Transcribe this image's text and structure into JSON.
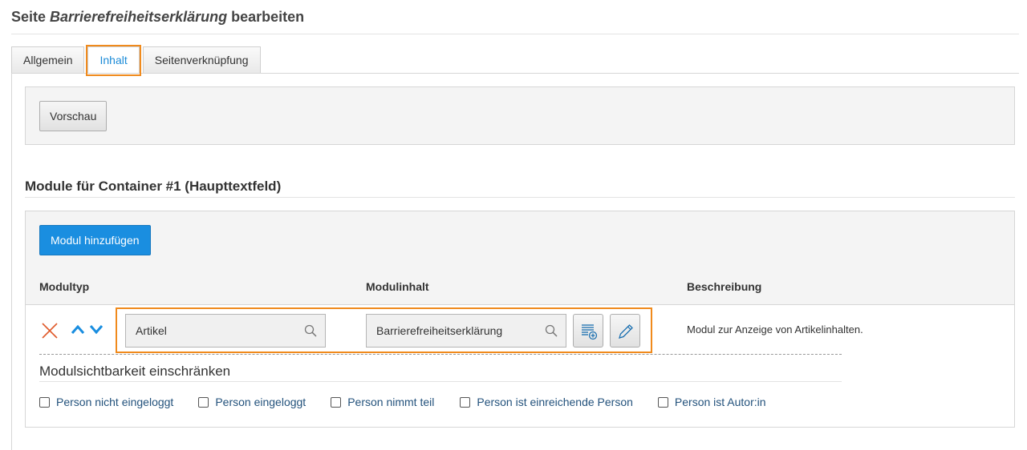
{
  "header": {
    "title_prefix": "Seite ",
    "title_name": "Barrierefreiheitserklärung",
    "title_suffix": " bearbeiten"
  },
  "tabs": [
    {
      "label": "Allgemein",
      "active": false
    },
    {
      "label": "Inhalt",
      "active": true
    },
    {
      "label": "Seitenverknüpfung",
      "active": false
    }
  ],
  "preview": {
    "button_label": "Vorschau"
  },
  "modules": {
    "section_title": "Module für Container #1 (Haupttextfeld)",
    "add_button_label": "Modul hinzufügen",
    "columns": {
      "type": "Modultyp",
      "content": "Modulinhalt",
      "description": "Beschreibung"
    },
    "rows": [
      {
        "type_value": "Artikel",
        "content_value": "Barrierefreiheitserklärung",
        "description": "Modul zur Anzeige von Artikelinhalten."
      }
    ],
    "visibility": {
      "title": "Modulsichtbarkeit einschränken",
      "options": [
        {
          "label": "Person nicht eingeloggt",
          "checked": false
        },
        {
          "label": "Person eingeloggt",
          "checked": false
        },
        {
          "label": "Person nimmt teil",
          "checked": false
        },
        {
          "label": "Person ist einreichende Person",
          "checked": false
        },
        {
          "label": "Person ist Autor:in",
          "checked": false
        }
      ]
    }
  },
  "icons": {
    "remove": "close-icon",
    "move_up": "chevron-up-icon",
    "move_down": "chevron-down-icon",
    "search": "search-icon",
    "list_add": "list-add-icon",
    "edit": "pencil-icon"
  },
  "colors": {
    "accent": "#1a8ee0",
    "highlight": "#f08a1c",
    "delete": "#e05a2b",
    "link": "#23527c"
  }
}
